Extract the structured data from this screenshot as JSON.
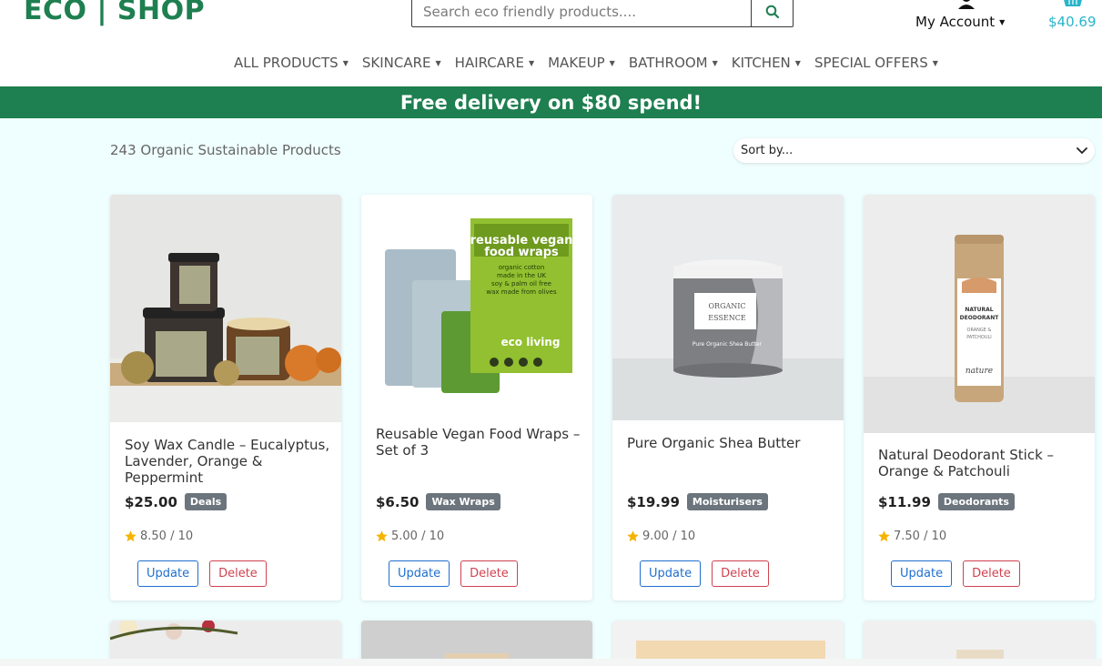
{
  "header": {
    "logo": "ECO | SHOP",
    "search_placeholder": "Search eco friendly products....",
    "account_label": "My Account",
    "cart_total": "$40.69",
    "icons": {
      "search": "magnifier-icon",
      "account": "user-icon",
      "cart": "basket-icon",
      "caret": "caret-down-icon"
    }
  },
  "nav": {
    "items": [
      {
        "label": "ALL PRODUCTS"
      },
      {
        "label": "SKINCARE"
      },
      {
        "label": "HAIRCARE"
      },
      {
        "label": "MAKEUP"
      },
      {
        "label": "BATHROOM"
      },
      {
        "label": "KITCHEN"
      },
      {
        "label": "SPECIAL OFFERS"
      }
    ]
  },
  "banner": {
    "text": "Free delivery on $80 spend!"
  },
  "toolbar": {
    "count_text": "243 Organic Sustainable Products",
    "sort_label": "Sort by..."
  },
  "products": [
    {
      "title": "Soy Wax Candle – Eucalyptus, Lavender, Orange & Peppermint",
      "price": "$25.00",
      "badge": "Deals",
      "rating": "8.50 / 10",
      "update": "Update",
      "delete": "Delete"
    },
    {
      "title": "Reusable Vegan Food Wraps – Set of 3",
      "price": "$6.50",
      "badge": "Wax Wraps",
      "rating": "5.00 / 10",
      "update": "Update",
      "delete": "Delete"
    },
    {
      "title": "Pure Organic Shea Butter",
      "price": "$19.99",
      "badge": "Moisturisers",
      "rating": "9.00 / 10",
      "update": "Update",
      "delete": "Delete"
    },
    {
      "title": "Natural Deodorant Stick – Orange & Patchouli",
      "price": "$11.99",
      "badge": "Deodorants",
      "rating": "7.50 / 10",
      "update": "Update",
      "delete": "Delete"
    }
  ],
  "image_text": {
    "wraps_pack_line1": "reusable vegan",
    "wraps_pack_line2": "food wraps",
    "wraps_pack_sub1": "organic cotton",
    "wraps_pack_sub2": "made in the UK",
    "wraps_pack_sub3": "soy & palm oil free",
    "wraps_pack_sub4": "wax made from olives",
    "wraps_brand": "eco living",
    "shea_brand1": "ORGANIC",
    "shea_brand2": "ESSENCE",
    "shea_product": "Pure Organic Shea Butter",
    "deo_line1": "NATURAL",
    "deo_line2": "DEODORANT",
    "deo_line3": "ORANGE &",
    "deo_line4": "PATCHOULI",
    "deo_brand": "nature"
  },
  "colors": {
    "brand_green": "#1e7f50",
    "cart_blue": "#28b5c9",
    "badge_grey": "#6c757d",
    "update_blue": "#1f6fd0",
    "delete_red": "#d0414f",
    "star": "#f5b400"
  }
}
